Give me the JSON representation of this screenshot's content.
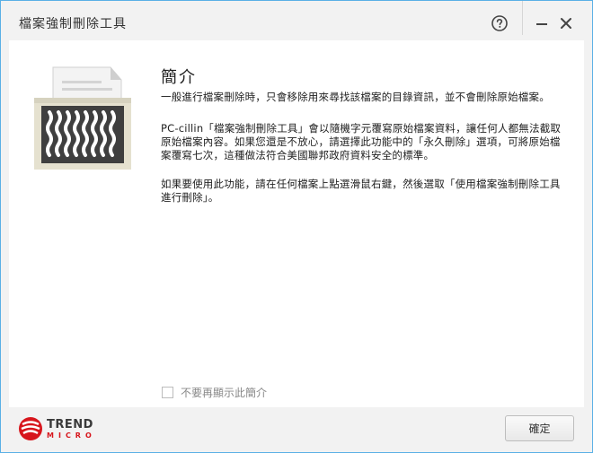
{
  "window": {
    "title": "檔案強制刪除工具"
  },
  "intro": {
    "heading": "簡介",
    "paragraphs": [
      "一般進行檔案刪除時，只會移除用來尋找該檔案的目錄資訊，並不會刪除原始檔案。",
      "PC-cillin「檔案強制刪除工具」會以隨機字元覆寫原始檔案資料，讓任何人都無法截取原始檔案內容。如果您還是不放心，請選擇此功能中的「永久刪除」選項，可將原始檔案覆寫七次，這種做法符合美國聯邦政府資料安全的標準。",
      "如果要使用此功能，請在任何檔案上點選滑鼠右鍵，然後選取「使用檔案強制刪除工具進行刪除」。"
    ]
  },
  "dont_show": {
    "label": "不要再顯示此簡介",
    "checked": false
  },
  "brand": {
    "top": "TREND",
    "bottom": "MICRO",
    "color": "#d7151c"
  },
  "footer": {
    "ok_label": "確定"
  },
  "icons": {
    "help": "help-icon",
    "minimize": "minimize-icon",
    "close": "close-icon",
    "shredder": "shredder-icon",
    "logo": "trend-micro-logo-icon"
  }
}
